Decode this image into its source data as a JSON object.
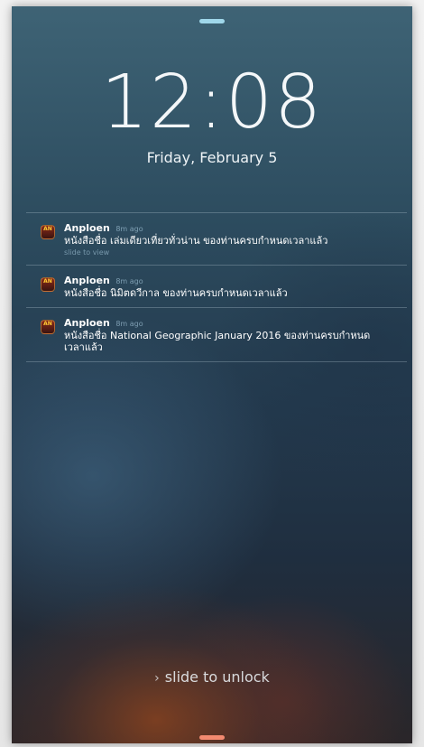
{
  "lockscreen": {
    "time": "12:08",
    "date": "Friday, February 5",
    "unlock_text": "slide to unlock",
    "unlock_icon": "chevron-right-icon",
    "grabber_top_color": "#9fd7ea",
    "grabber_bottom_color": "#f28a70"
  },
  "notifications": [
    {
      "app": "Anploen",
      "app_icon_text": "AN",
      "time_ago": "8m ago",
      "message": "หนังสือชื่อ เล่มเดียวเที่ยวทั่วน่าน ของท่านครบกำหนดเวลาแล้ว",
      "hint": "slide to view"
    },
    {
      "app": "Anploen",
      "app_icon_text": "AN",
      "time_ago": "8m ago",
      "message": "หนังสือชื่อ นิมิตดวีกาล ของท่านครบกำหนดเวลาแล้ว"
    },
    {
      "app": "Anploen",
      "app_icon_text": "AN",
      "time_ago": "8m ago",
      "message": "หนังสือชื่อ National Geographic January 2016 ของท่านครบกำหนดเวลาแล้ว"
    }
  ]
}
